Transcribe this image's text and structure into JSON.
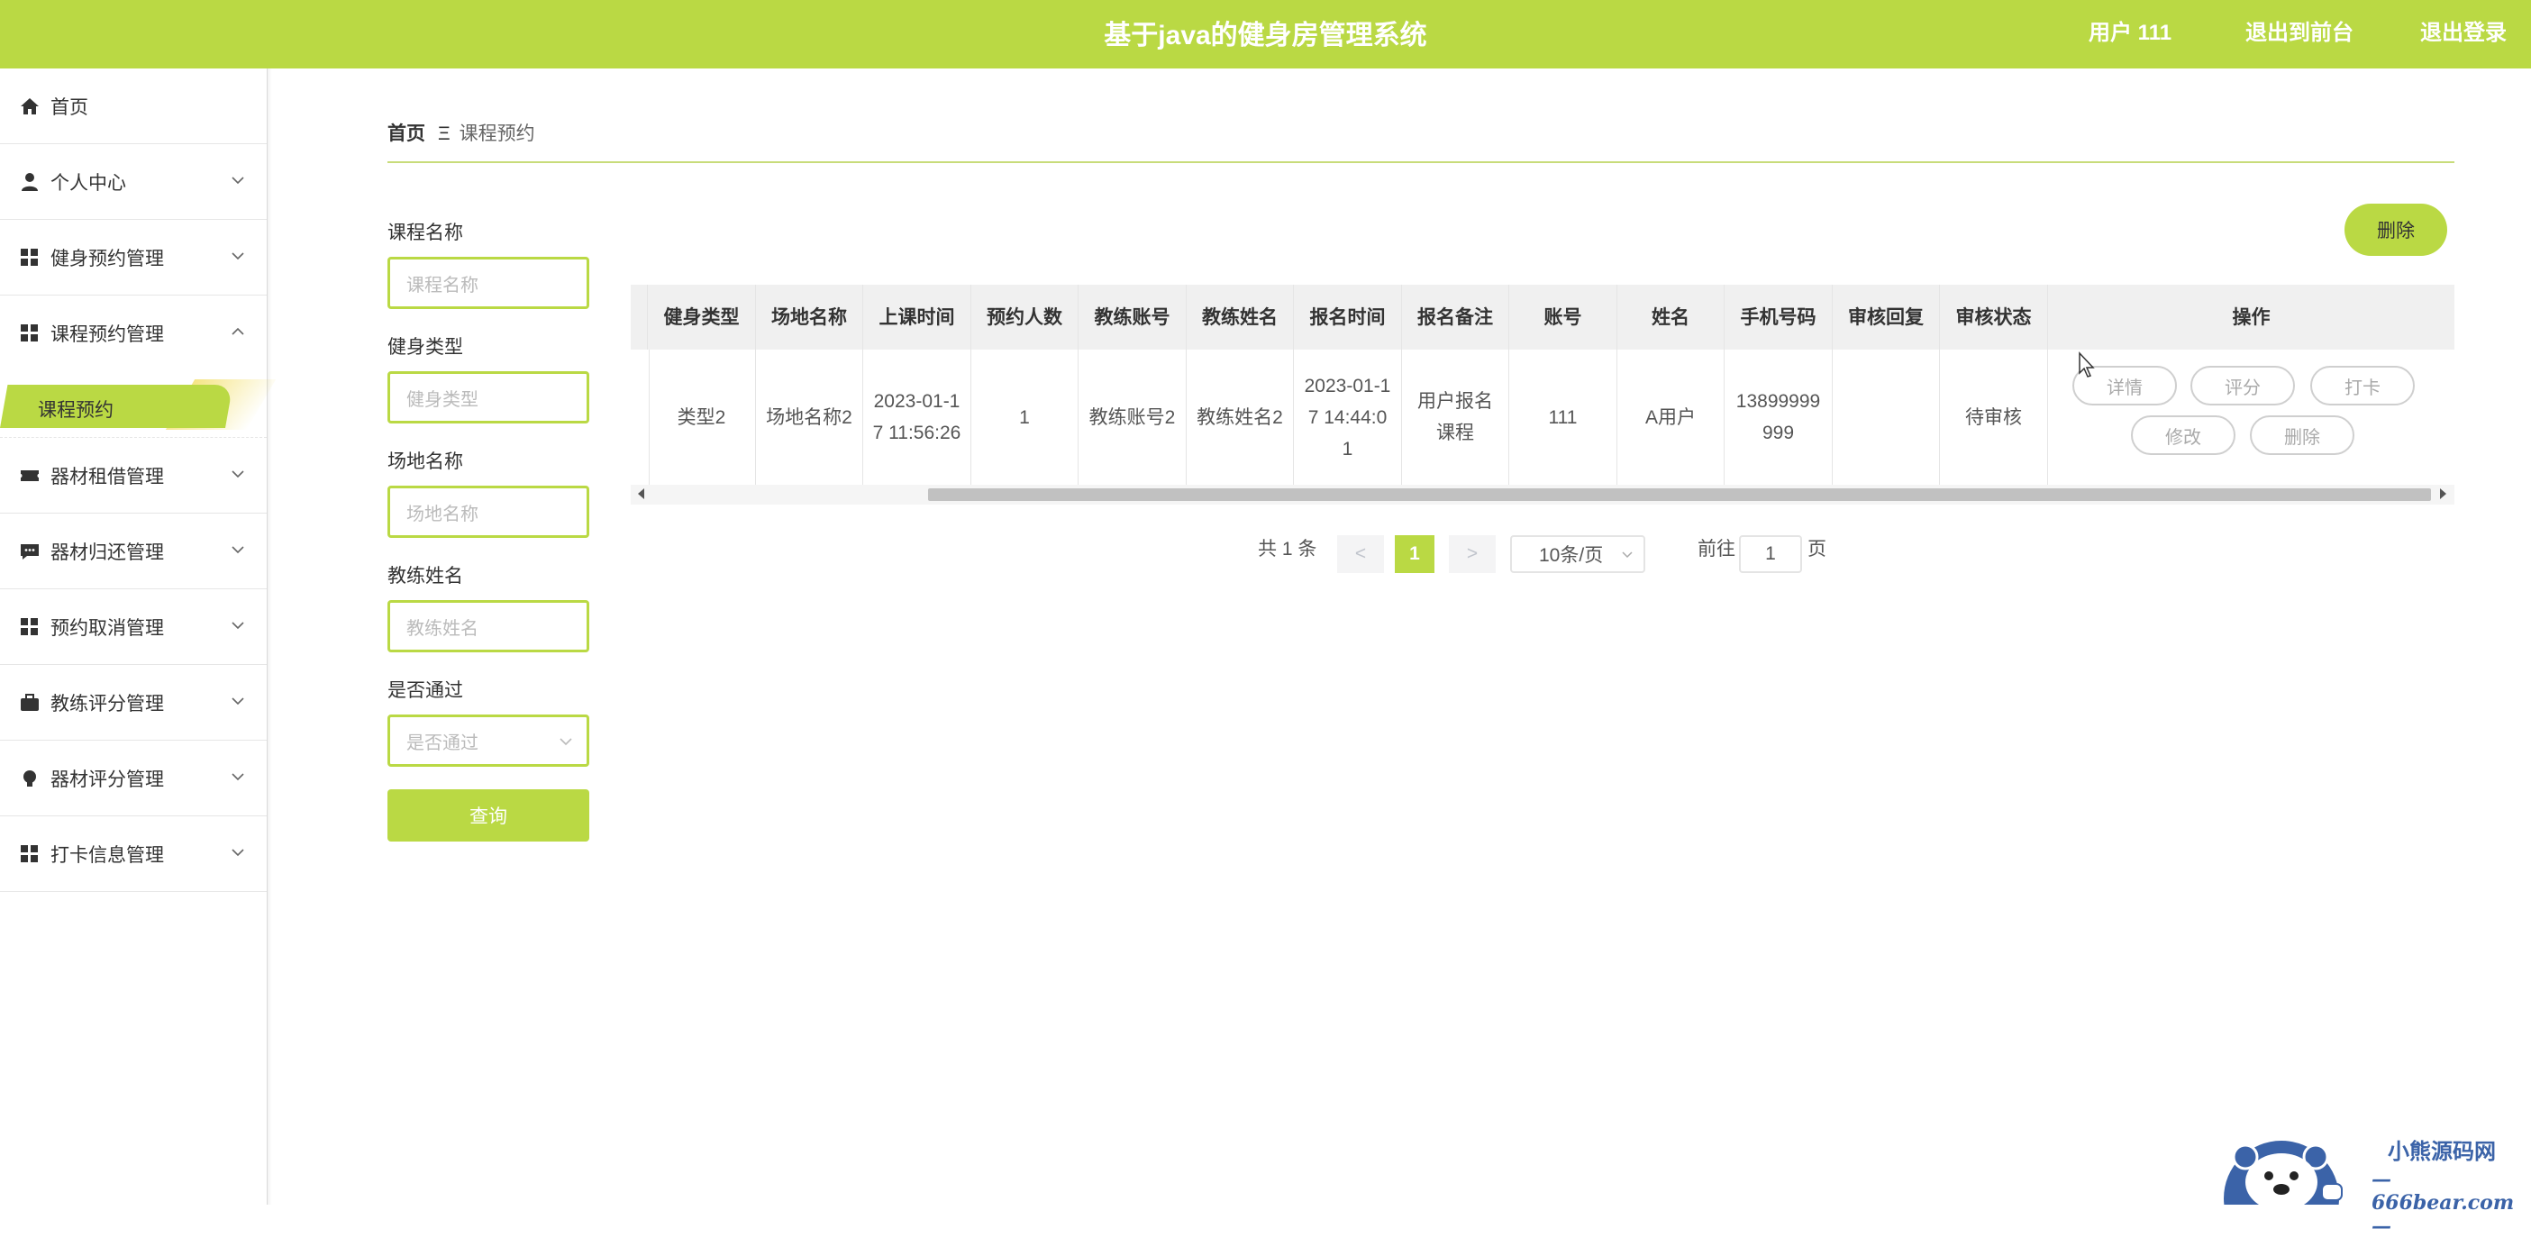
{
  "header": {
    "title": "基于java的健身房管理系统",
    "user": "用户 111",
    "back_to_front": "退出到前台",
    "logout": "退出登录"
  },
  "sidebar": {
    "items": [
      {
        "label": "首页",
        "icon": "home-icon"
      },
      {
        "label": "个人中心",
        "icon": "person-icon"
      },
      {
        "label": "健身预约管理",
        "icon": "grid-icon"
      },
      {
        "label": "课程预约管理",
        "icon": "grid-icon",
        "expanded": true
      },
      {
        "label": "器材租借管理",
        "icon": "ticket-icon"
      },
      {
        "label": "器材归还管理",
        "icon": "chat-icon"
      },
      {
        "label": "预约取消管理",
        "icon": "grid-icon"
      },
      {
        "label": "教练评分管理",
        "icon": "briefcase-icon"
      },
      {
        "label": "器材评分管理",
        "icon": "bulb-icon"
      },
      {
        "label": "打卡信息管理",
        "icon": "grid-icon"
      }
    ],
    "active_submenu": "课程预约"
  },
  "breadcrumb": {
    "home": "首页",
    "separator": "Ξ",
    "current": "课程预约"
  },
  "search": {
    "course_name": {
      "label": "课程名称",
      "placeholder": "课程名称"
    },
    "fitness_type": {
      "label": "健身类型",
      "placeholder": "健身类型"
    },
    "venue_name": {
      "label": "场地名称",
      "placeholder": "场地名称"
    },
    "coach_name": {
      "label": "教练姓名",
      "placeholder": "教练姓名"
    },
    "approved": {
      "label": "是否通过",
      "placeholder": "是否通过"
    },
    "query_button": "查询"
  },
  "toolbar": {
    "delete_button": "删除"
  },
  "table": {
    "headers": [
      "健身类型",
      "场地名称",
      "上课时间",
      "预约人数",
      "教练账号",
      "教练姓名",
      "报名时间",
      "报名备注",
      "账号",
      "姓名",
      "手机号码",
      "审核回复",
      "审核状态",
      "操作"
    ],
    "rows": [
      {
        "cells": [
          "类型2",
          "场地名称2",
          "2023-01-17 11:56:26",
          "1",
          "教练账号2",
          "教练姓名2",
          "2023-01-17 14:44:01",
          "用户报名课程",
          "111",
          "A用户",
          "13899999999",
          "",
          "待审核"
        ],
        "actions": [
          "详情",
          "评分",
          "打卡",
          "修改",
          "删除"
        ]
      }
    ]
  },
  "pagination": {
    "total_text": "共 1 条",
    "prev": "<",
    "current_page": "1",
    "next": ">",
    "page_size": "10条/页",
    "goto_label": "前往",
    "goto_value": "1",
    "page_suffix": "页"
  },
  "watermark": {
    "site_name": "小熊源码网",
    "domain": "—666bear.com—"
  },
  "colors": {
    "accent": "#bad944",
    "sidebar_highlight": "#f4e278"
  }
}
